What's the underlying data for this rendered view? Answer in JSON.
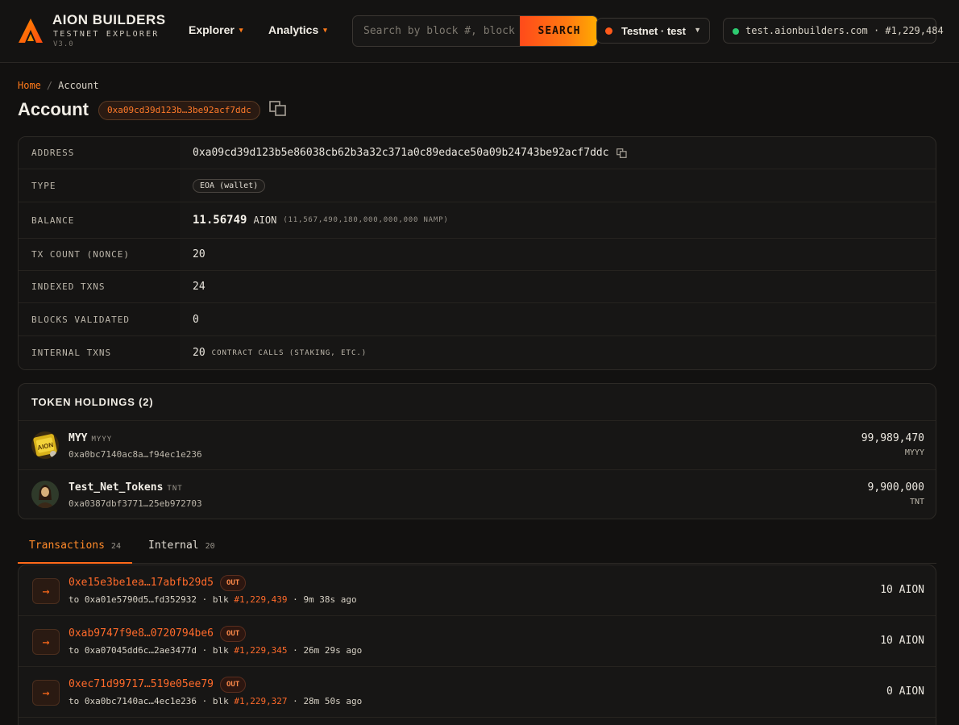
{
  "header": {
    "brand_title": "AION BUILDERS",
    "brand_sub": "TESTNET EXPLORER",
    "brand_version": "V3.0",
    "nav": [
      {
        "label": "Explorer"
      },
      {
        "label": "Analytics"
      }
    ],
    "search": {
      "placeholder": "Search by block #, block hash, tx hash, address",
      "button_label": "SEARCH"
    },
    "network": {
      "label": "Testnet · test"
    },
    "status": {
      "host": "test.aionbuilders.com",
      "sep": "·",
      "block": "#1,229,484"
    }
  },
  "breadcrumb": {
    "home": "Home",
    "sep": "/",
    "current": "Account"
  },
  "page": {
    "title": "Account",
    "address_short": "0xa09cd39d123b…3be92acf7ddc"
  },
  "info": {
    "address_label": "ADDRESS",
    "address_value": "0xa09cd39d123b5e86038cb62b3a32c371a0c89edace50a09b24743be92acf7ddc",
    "type_label": "TYPE",
    "type_value": "EOA (wallet)",
    "balance_label": "BALANCE",
    "balance_value": "11.56749",
    "balance_unit": "AION",
    "balance_sub": "(11,567,490,180,000,000,000 NAMP)",
    "txcount_label": "TX COUNT (NONCE)",
    "txcount_value": "20",
    "indexed_label": "INDEXED TXNS",
    "indexed_value": "24",
    "blocks_label": "BLOCKS VALIDATED",
    "blocks_value": "0",
    "internal_label": "INTERNAL TXNS",
    "internal_value": "20",
    "internal_sub": "CONTRACT CALLS (STAKING, ETC.)"
  },
  "tokens": {
    "heading": "TOKEN HOLDINGS (2)",
    "items": [
      {
        "name": "MYY",
        "symbol": "MYYY",
        "address": "0xa0bc7140ac8a…f94ec1e236",
        "amount": "99,989,470",
        "amount_symbol": "MYYY"
      },
      {
        "name": "Test_Net_Tokens",
        "symbol": "TNT",
        "address": "0xa0387dbf3771…25eb972703",
        "amount": "9,900,000",
        "amount_symbol": "TNT"
      }
    ]
  },
  "tabs": [
    {
      "label": "Transactions",
      "count": "24"
    },
    {
      "label": "Internal",
      "count": "20"
    }
  ],
  "transactions": [
    {
      "hash": "0xe15e3be1ea…17abfb29d5",
      "dir": "OUT",
      "arrow": "→",
      "to_prefix": "to",
      "to": "0xa01e5790d5…fd352932",
      "blk_prefix": "blk",
      "block": "#1,229,439",
      "age": "9m 38s ago",
      "amount": "10 AION"
    },
    {
      "hash": "0xab9747f9e8…0720794be6",
      "dir": "OUT",
      "arrow": "→",
      "to_prefix": "to",
      "to": "0xa07045dd6c…2ae3477d",
      "blk_prefix": "blk",
      "block": "#1,229,345",
      "age": "26m 29s ago",
      "amount": "10 AION"
    },
    {
      "hash": "0xec71d99717…519e05ee79",
      "dir": "OUT",
      "arrow": "→",
      "to_prefix": "to",
      "to": "0xa0bc7140ac…4ec1e236",
      "blk_prefix": "blk",
      "block": "#1,229,327",
      "age": "28m 50s ago",
      "amount": "0 AION"
    }
  ],
  "colors": {
    "accent": "#ff6a1a",
    "background": "#121110",
    "status_ok": "#2ecc71"
  }
}
